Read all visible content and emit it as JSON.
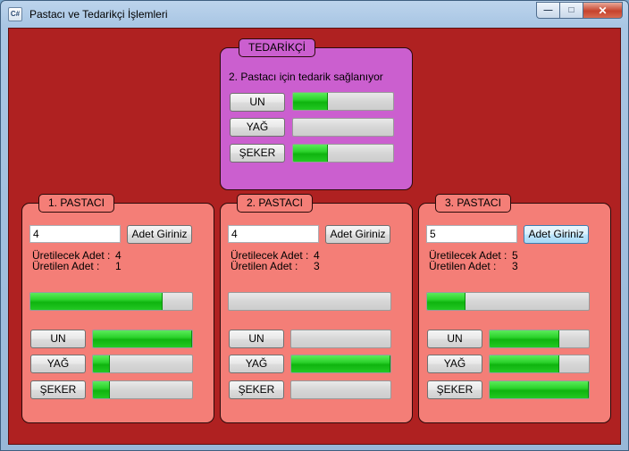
{
  "window": {
    "title": "Pastacı ve Tedarikçi İşlemleri",
    "icon": "C#"
  },
  "caption": {
    "min": "—",
    "max": "□",
    "close": "✕"
  },
  "supplier": {
    "legend": "TEDARİKÇİ",
    "status": "2. Pastacı için tedarik sağlanıyor",
    "items": [
      {
        "label": "UN",
        "progress": 35
      },
      {
        "label": "YAĞ",
        "progress": 0
      },
      {
        "label": "ŞEKER",
        "progress": 35
      }
    ]
  },
  "bakers": [
    {
      "legend": "1. PASTACI",
      "input_value": "4",
      "button": "Adet Giriniz",
      "to_produce_label": "Üretilecek Adet :",
      "to_produce": "4",
      "produced_label": "Üretilen Adet :",
      "produced": "1",
      "main_progress": 82,
      "items": [
        {
          "label": "UN",
          "progress": 100
        },
        {
          "label": "YAĞ",
          "progress": 17
        },
        {
          "label": "ŞEKER",
          "progress": 17
        }
      ]
    },
    {
      "legend": "2. PASTACI",
      "input_value": "4",
      "button": "Adet Giriniz",
      "to_produce_label": "Üretilecek Adet :",
      "to_produce": "4",
      "produced_label": "Üretilen Adet :",
      "produced": "3",
      "main_progress": 0,
      "items": [
        {
          "label": "UN",
          "progress": 0
        },
        {
          "label": "YAĞ",
          "progress": 100
        },
        {
          "label": "ŞEKER",
          "progress": 0
        }
      ]
    },
    {
      "legend": "3. PASTACI",
      "input_value": "5",
      "button": "Adet Giriniz",
      "to_produce_label": "Üretilecek Adet :",
      "to_produce": "5",
      "produced_label": "Üretilen Adet :",
      "produced": "3",
      "main_progress": 24,
      "items": [
        {
          "label": "UN",
          "progress": 70
        },
        {
          "label": "YAĞ",
          "progress": 70
        },
        {
          "label": "ŞEKER",
          "progress": 100
        }
      ]
    }
  ]
}
